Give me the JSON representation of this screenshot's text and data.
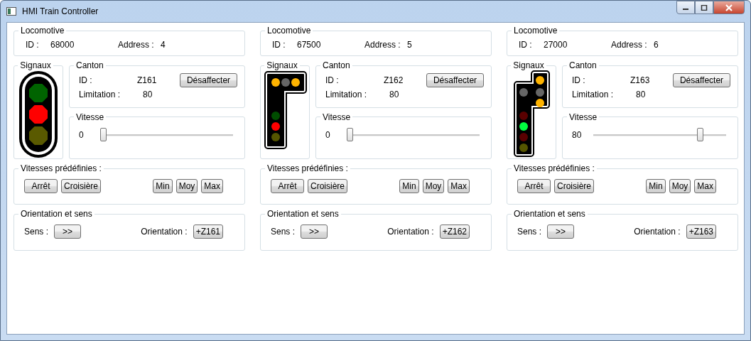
{
  "window": {
    "title": "HMI Train Controller"
  },
  "panels": [
    {
      "locomotive": {
        "title": "Locomotive",
        "id_label": "ID :",
        "id": "68000",
        "address_label": "Address :",
        "address": "4"
      },
      "signals": {
        "title": "Signaux",
        "kind": "round",
        "lamps": [
          {
            "color": "#006400"
          },
          {
            "color": "#ff0000"
          },
          {
            "color": "#5a5a00"
          }
        ]
      },
      "canton": {
        "title": "Canton",
        "id_label": "ID :",
        "id": "Z161",
        "limit_label": "Limitation :",
        "limit": "80",
        "button": "Désaffecter"
      },
      "speed": {
        "title": "Vitesse",
        "value": "0",
        "level": 0
      },
      "presets": {
        "title": "Vitesses prédéfinies :",
        "left": [
          "Arrêt",
          "Croisière"
        ],
        "right": [
          "Min",
          "Moy",
          "Max"
        ]
      },
      "orientation": {
        "title": "Orientation et sens",
        "sens_label": "Sens :",
        "sens": ">>",
        "orient_label": "Orientation :",
        "orient": "+Z161"
      }
    },
    {
      "locomotive": {
        "title": "Locomotive",
        "id_label": "ID :",
        "id": "67500",
        "address_label": "Address :",
        "address": "5"
      },
      "signals": {
        "title": "Signaux",
        "kind": "bracket",
        "lamps": [
          {
            "color": "#ffb400"
          },
          {
            "color": "#666666"
          },
          {
            "color": "#ffb400"
          },
          {
            "color": "#004d00"
          },
          {
            "color": "#ff0000"
          },
          {
            "color": "#555500"
          }
        ]
      },
      "canton": {
        "title": "Canton",
        "id_label": "ID :",
        "id": "Z162",
        "limit_label": "Limitation :",
        "limit": "80",
        "button": "Désaffecter"
      },
      "speed": {
        "title": "Vitesse",
        "value": "0",
        "level": 0
      },
      "presets": {
        "title": "Vitesses prédéfinies :",
        "left": [
          "Arrêt",
          "Croisière"
        ],
        "right": [
          "Min",
          "Moy",
          "Max"
        ]
      },
      "orientation": {
        "title": "Orientation et sens",
        "sens_label": "Sens :",
        "sens": ">>",
        "orient_label": "Orientation :",
        "orient": "+Z162"
      }
    },
    {
      "locomotive": {
        "title": "Locomotive",
        "id_label": "ID :",
        "id": "27000",
        "address_label": "Address :",
        "address": "6"
      },
      "signals": {
        "title": "Signaux",
        "kind": "tall",
        "lamps": [
          {
            "color": "#ffb400"
          },
          {
            "color": "#666666"
          },
          {
            "color": "#666666"
          },
          {
            "color": "#ffb400"
          },
          {
            "color": "#5a0000"
          },
          {
            "color": "#00ff40"
          },
          {
            "color": "#5a0000"
          },
          {
            "color": "#555500"
          }
        ]
      },
      "canton": {
        "title": "Canton",
        "id_label": "ID :",
        "id": "Z163",
        "limit_label": "Limitation :",
        "limit": "80",
        "button": "Désaffecter"
      },
      "speed": {
        "title": "Vitesse",
        "value": "80",
        "level": 0.78
      },
      "presets": {
        "title": "Vitesses prédéfinies :",
        "left": [
          "Arrêt",
          "Croisière"
        ],
        "right": [
          "Min",
          "Moy",
          "Max"
        ]
      },
      "orientation": {
        "title": "Orientation et sens",
        "sens_label": "Sens :",
        "sens": ">>",
        "orient_label": "Orientation :",
        "orient": "+Z163"
      }
    }
  ]
}
